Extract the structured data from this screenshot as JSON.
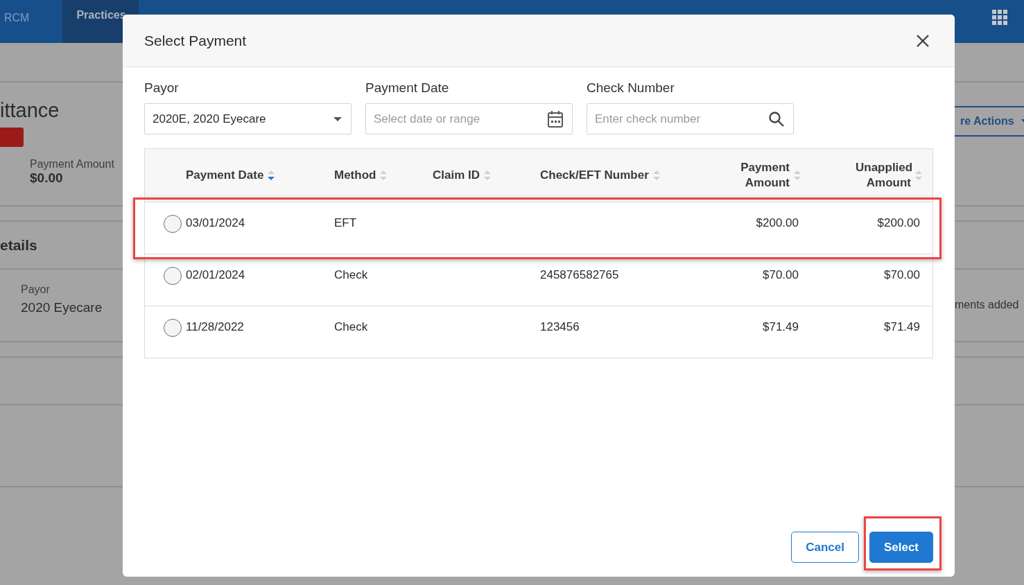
{
  "nav": {
    "items": [
      {
        "label": "RCM",
        "selected": false
      },
      {
        "label": "Practices",
        "selected": true
      }
    ]
  },
  "background": {
    "title": "ittance",
    "amount_label": "Payment Amount",
    "amount": "$0.00",
    "actions_button": "re Actions",
    "section_title": "etails",
    "payor_label": "Payor",
    "payor": "2020 Eyecare",
    "note": "ments added"
  },
  "dialog": {
    "title": "Select Payment",
    "filters": [
      {
        "kind": "select",
        "label": "Payor",
        "value": "2020E, 2020 Eyecare"
      },
      {
        "kind": "date",
        "label": "Payment Date",
        "placeholder": "Select date or range"
      },
      {
        "kind": "search",
        "label": "Check Number",
        "placeholder": "Enter check number"
      }
    ],
    "table": {
      "columns": [
        {
          "label": "Payment Date",
          "sorted": true,
          "kind": "text"
        },
        {
          "label": "Method",
          "sorted": false,
          "kind": "text"
        },
        {
          "label": "Claim ID",
          "sorted": false,
          "kind": "text"
        },
        {
          "label": "Check/EFT Number",
          "sorted": false,
          "kind": "text"
        },
        {
          "label": "Payment Amount",
          "sorted": false,
          "kind": "amount"
        },
        {
          "label": "Unapplied Amount",
          "sorted": false,
          "kind": "amount"
        }
      ],
      "rows": [
        {
          "selected": false,
          "highlighted": true,
          "payment_date": "03/01/2024",
          "method": "EFT",
          "payment_amount": "$200.00",
          "unapplied_amount": "$200.00"
        },
        {
          "selected": false,
          "highlighted": false,
          "payment_date": "02/01/2024",
          "method": "Check",
          "check_eft_number": "245876582765",
          "payment_amount": "$70.00",
          "unapplied_amount": "$70.00"
        },
        {
          "selected": false,
          "highlighted": false,
          "payment_date": "11/28/2022",
          "method": "Check",
          "check_eft_number": "123456",
          "payment_amount": "$71.49",
          "unapplied_amount": "$71.49"
        }
      ]
    },
    "buttons": [
      {
        "label": "Cancel",
        "kind": "secondary",
        "highlighted": false
      },
      {
        "label": "Select",
        "kind": "primary",
        "highlighted": true
      }
    ]
  }
}
